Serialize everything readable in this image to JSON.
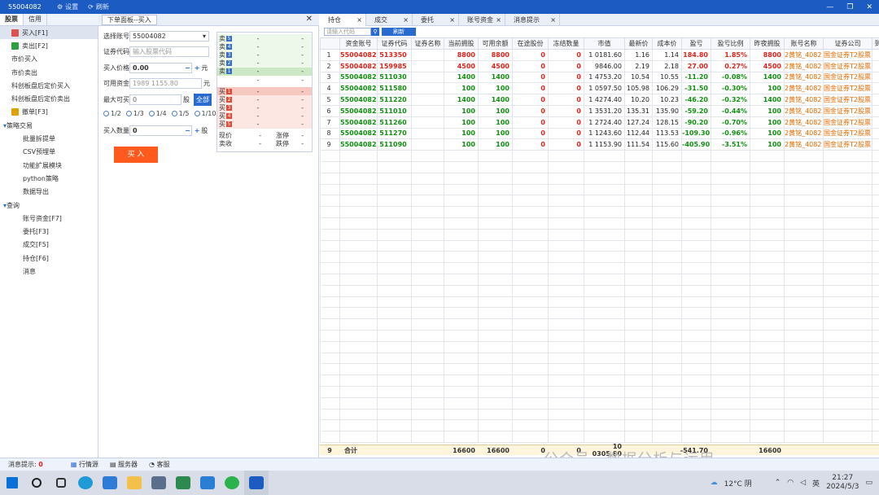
{
  "titlebar": {
    "account": "55004082",
    "settings": "设置",
    "refresh": "刷新"
  },
  "left_tabs": [
    "股票",
    "信用"
  ],
  "nav": [
    {
      "label": "买入[F1]",
      "icon": "buy-icon",
      "color": "#d9534f",
      "level": 1
    },
    {
      "label": "卖出[F2]",
      "icon": "sell-icon",
      "color": "#2e9e3e",
      "level": 1
    },
    {
      "label": "市价买入",
      "level": 0
    },
    {
      "label": "市价卖出",
      "level": 0
    },
    {
      "label": "科创板盘后定价买入",
      "level": 0
    },
    {
      "label": "科创板盘后定价卖出",
      "level": 0
    },
    {
      "label": "撤单[F3]",
      "icon": "undo-icon",
      "color": "#e0a000",
      "level": 1
    },
    {
      "label": "策略交易",
      "level": "group"
    },
    {
      "label": "批量拆提单",
      "level": 2
    },
    {
      "label": "CSV预埋单",
      "level": 2
    },
    {
      "label": "功能扩展模块",
      "level": 2
    },
    {
      "label": "python策略",
      "level": 2
    },
    {
      "label": "数据导出",
      "level": 2
    },
    {
      "label": "查询",
      "level": "group"
    },
    {
      "label": "账号资金[F7]",
      "level": 2
    },
    {
      "label": "委托[F3]",
      "level": 2
    },
    {
      "label": "成交[F5]",
      "level": 2
    },
    {
      "label": "持仓[F6]",
      "level": 2
    },
    {
      "label": "消息",
      "level": 2
    }
  ],
  "order_panel": {
    "title": "下单面板--买入",
    "account_label": "选择账号",
    "account_value": "55004082",
    "code_label": "证券代码",
    "code_placeholder": "输入股票代码",
    "price_label": "买入价格",
    "price_value": "0.00",
    "price_unit": "元",
    "funds_label": "可用资金",
    "funds_value": "1989 1155.80",
    "funds_unit": "元",
    "max_label": "最大可买",
    "max_value": "0",
    "max_unit": "股",
    "all_btn": "全部",
    "ratios": [
      "1/2",
      "1/3",
      "1/4",
      "1/5",
      "1/10"
    ],
    "qty_label": "买入数量",
    "qty_value": "0",
    "qty_unit": "股",
    "buy_button": "买 入"
  },
  "order_book": {
    "asks": [
      {
        "lv": "卖",
        "n": "5"
      },
      {
        "lv": "卖",
        "n": "4"
      },
      {
        "lv": "卖",
        "n": "3"
      },
      {
        "lv": "卖",
        "n": "2"
      },
      {
        "lv": "卖",
        "n": "1"
      }
    ],
    "mid": "-",
    "bids": [
      {
        "lv": "买",
        "n": "1"
      },
      {
        "lv": "买",
        "n": "2"
      },
      {
        "lv": "买",
        "n": "3"
      },
      {
        "lv": "买",
        "n": "4"
      },
      {
        "lv": "买",
        "n": "5"
      }
    ],
    "dash": "-",
    "footer": [
      [
        "现价",
        "-",
        "涨停",
        "-"
      ],
      [
        "卖收",
        "-",
        "跌停",
        "-"
      ]
    ]
  },
  "right_tabs": [
    "持仓",
    "成交",
    "委托",
    "账号资金",
    "消息提示"
  ],
  "search": {
    "placeholder": "请输入代码",
    "refresh": "刷新"
  },
  "table": {
    "headers": [
      "",
      "资金账号",
      "证券代码",
      "证券名称",
      "当前拥股",
      "可用余额",
      "在途股份",
      "冻结数量",
      "市值",
      "最新价",
      "成本价",
      "盈亏",
      "盈亏比例",
      "昨夜拥股",
      "账号名称",
      "证券公司",
      "到期"
    ],
    "rows": [
      [
        "1",
        "55004082",
        "513350",
        "",
        "8800",
        "8800",
        "0",
        "0",
        "1 0181.60",
        "1.16",
        "1.14",
        "184.80",
        "1.85%",
        "8800",
        "2黄铭_4082",
        "国金证券T2股票",
        "r"
      ],
      [
        "2",
        "55004082",
        "159985",
        "",
        "4500",
        "4500",
        "0",
        "0",
        "9846.00",
        "2.19",
        "2.18",
        "27.00",
        "0.27%",
        "4500",
        "2黄铭_4082",
        "国金证券T2股票",
        "r"
      ],
      [
        "3",
        "55004082",
        "511030",
        "",
        "1400",
        "1400",
        "0",
        "0",
        "1 4753.20",
        "10.54",
        "10.55",
        "-11.20",
        "-0.08%",
        "1400",
        "2黄铭_4082",
        "国金证券T2股票",
        "g"
      ],
      [
        "4",
        "55004082",
        "511580",
        "",
        "100",
        "100",
        "0",
        "0",
        "1 0597.50",
        "105.98",
        "106.29",
        "-31.50",
        "-0.30%",
        "100",
        "2黄铭_4082",
        "国金证券T2股票",
        "g"
      ],
      [
        "5",
        "55004082",
        "511220",
        "",
        "1400",
        "1400",
        "0",
        "0",
        "1 4274.40",
        "10.20",
        "10.23",
        "-46.20",
        "-0.32%",
        "1400",
        "2黄铭_4082",
        "国金证券T2股票",
        "g"
      ],
      [
        "6",
        "55004082",
        "511010",
        "",
        "100",
        "100",
        "0",
        "0",
        "1 3531.20",
        "135.31",
        "135.90",
        "-59.20",
        "-0.44%",
        "100",
        "2黄铭_4082",
        "国金证券T2股票",
        "g"
      ],
      [
        "7",
        "55004082",
        "511260",
        "",
        "100",
        "100",
        "0",
        "0",
        "1 2724.40",
        "127.24",
        "128.15",
        "-90.20",
        "-0.70%",
        "100",
        "2黄铭_4082",
        "国金证券T2股票",
        "g"
      ],
      [
        "8",
        "55004082",
        "511270",
        "",
        "100",
        "100",
        "0",
        "0",
        "1 1243.60",
        "112.44",
        "113.53",
        "-109.30",
        "-0.96%",
        "100",
        "2黄铭_4082",
        "国金证券T2股票",
        "g"
      ],
      [
        "9",
        "55004082",
        "511090",
        "",
        "100",
        "100",
        "0",
        "0",
        "1 1153.90",
        "111.54",
        "115.60",
        "-405.90",
        "-3.51%",
        "100",
        "2黄铭_4082",
        "国金证券T2股票",
        "g"
      ]
    ],
    "summary": {
      "count": "9",
      "label": "合计",
      "hold": "16600",
      "avail": "16600",
      "transit": "0",
      "frozen": "0",
      "value": "10 0305.80",
      "pnl": "-541.70",
      "yest": "16600"
    }
  },
  "status": {
    "msg_label": "消息提示:",
    "msg_count": "0",
    "quote": "行情源",
    "server": "服务器",
    "service": "客服"
  },
  "watermark": "公众号 · 数据分析与运用",
  "tray": {
    "weather": "12°C 阴",
    "ime": "英",
    "time": "21:27",
    "date": "2024/5/3"
  },
  "colors": {
    "accent": "#1c5cc2",
    "profit": "#e2231a",
    "loss": "#109010",
    "buy": "#ff5a1e"
  }
}
